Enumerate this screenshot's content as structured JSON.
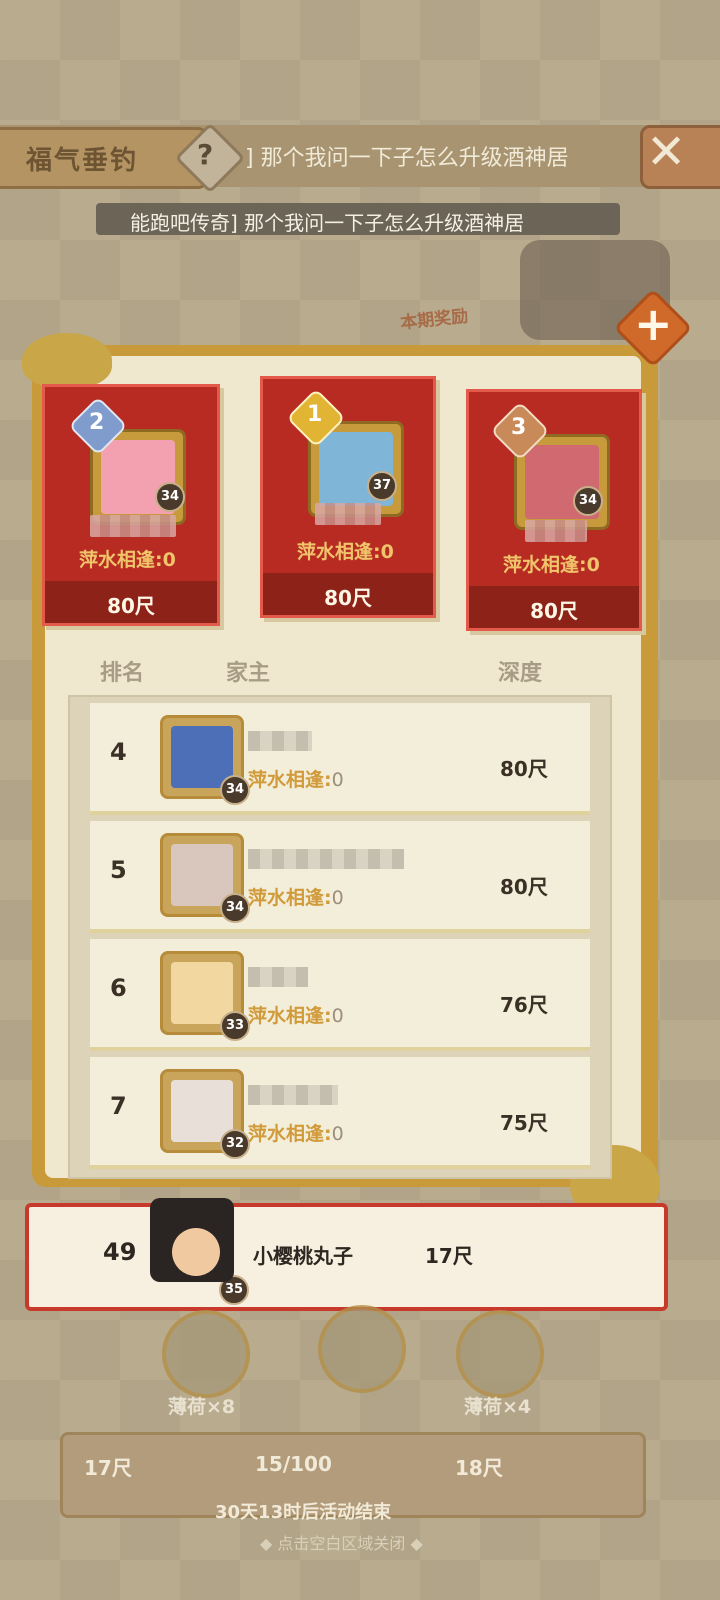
{
  "header": {
    "title": "福气垂钓",
    "help_label": "?",
    "marquee_top": "] 那个我问一下子怎么升级酒神居",
    "marquee_main": "能跑吧传奇] 那个我问一下子怎么升级酒神居",
    "close_label": "✕"
  },
  "background_label": "本期奖励",
  "podium": [
    {
      "rank": "2",
      "level": "34",
      "tag": "萍水相逢:0",
      "depth": "80尺"
    },
    {
      "rank": "1",
      "level": "37",
      "tag": "萍水相逢:0",
      "depth": "80尺"
    },
    {
      "rank": "3",
      "level": "34",
      "tag": "萍水相逢:0",
      "depth": "80尺"
    }
  ],
  "columns": {
    "rank": "排名",
    "owner": "家主",
    "depth": "深度"
  },
  "rows": [
    {
      "rank": "4",
      "level": "34",
      "tag": "萍水相逢:",
      "tag_value": "0",
      "depth": "80尺"
    },
    {
      "rank": "5",
      "level": "34",
      "tag": "萍水相逢:",
      "tag_value": "0",
      "depth": "80尺"
    },
    {
      "rank": "6",
      "level": "33",
      "tag": "萍水相逢:",
      "tag_value": "0",
      "depth": "76尺"
    },
    {
      "rank": "7",
      "level": "32",
      "tag": "萍水相逢:",
      "tag_value": "0",
      "depth": "75尺"
    }
  ],
  "me": {
    "rank": "49",
    "name": "小樱桃丸子",
    "depth": "17尺",
    "level": "35"
  },
  "rewards": [
    {
      "label": "薄荷×8"
    },
    {
      "label": "薄荷×4"
    }
  ],
  "bottom": {
    "left_depth": "17尺",
    "progress": "15/100",
    "right_depth": "18尺",
    "ends_text": "30天13时后活动结束",
    "close_hint": "◆ 点击空白区域关闭 ◆"
  },
  "colors": {
    "panel_gold": "#c99a3a",
    "podium_red": "#b82b23",
    "tag_gold": "#d19a3a"
  }
}
